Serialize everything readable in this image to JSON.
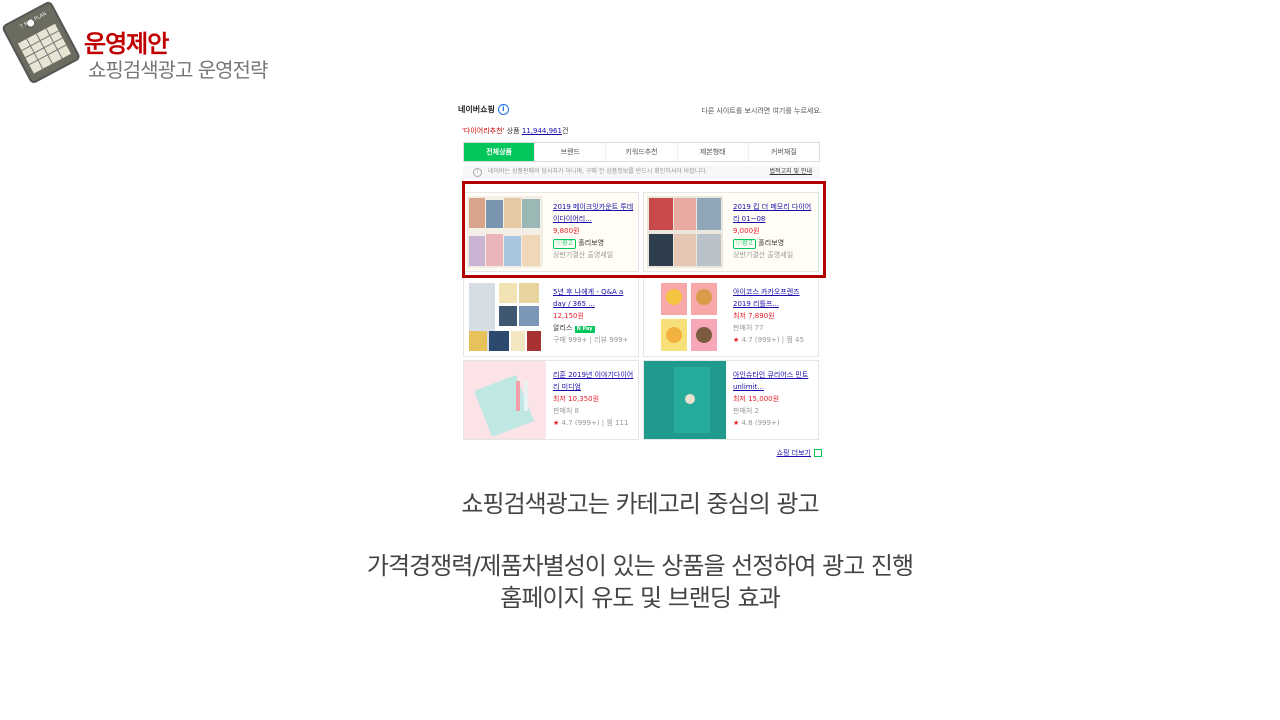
{
  "header": {
    "title": "운영제안",
    "subtitle": "쇼핑검색광고 운영전략",
    "tag_text": "T NAY PLAN"
  },
  "screenshot": {
    "brand": "네이버쇼핑",
    "other_site_note": "다른 사이트를 보시려면 여기를 누르세요.",
    "keyword": "'다이어리추천'",
    "count_label": "상품",
    "count_value": "11,944,961",
    "count_suffix": "건",
    "tabs": [
      "전체상품",
      "브랜드",
      "키워드추천",
      "제본형태",
      "커버재질"
    ],
    "notice": "네이버는 상품판매의 당사자가 아니며, 구매 전 상품정보를 반드시 확인하셔야 바랍니다.",
    "notice_link": "법적고지 및 안내",
    "products": [
      {
        "name": "2019 메이크잇카운트 투데이다이어리...",
        "price": "9,800원",
        "badge": "광고",
        "seller": "홀리보영",
        "extra": "상반기결산 출영세일",
        "is_ad": true
      },
      {
        "name": "2019 킵 더 메모리 다이어리 01~08",
        "price": "9,000원",
        "badge": "광고",
        "seller": "홀리보영",
        "extra": "상반기결산 출영세일",
        "is_ad": true
      },
      {
        "name": "5년 후 나에게 - Q&A a day / 365 ...",
        "price": "12,150원",
        "seller": "알리스",
        "npay": "N Pay",
        "extra": "구매 999+ | 리뷰 999+"
      },
      {
        "name": "아이코스 카카오프렌즈 2019 리틀프...",
        "price": "최저 7,890원",
        "seller": "판매처 77",
        "rating": "4.7 (999+) | 찜 45"
      },
      {
        "name": "리훈 2019년 이야기다이어리 미디엄",
        "price": "최저 10,350원",
        "seller": "판매처 8",
        "rating": "4.7 (999+) | 찜 111"
      },
      {
        "name": "아인슈타인 큐리어스 민트 unlimit...",
        "price": "최저 15,000원",
        "seller": "판매처 2",
        "rating": "4.8 (999+)"
      }
    ],
    "more_link": "쇼핑 더보기"
  },
  "captions": {
    "line1": "쇼핑검색광고는 카테고리 중심의 광고",
    "line2": "가격경쟁력/제품차별성이 있는 상품을 선정하여 광고 진행",
    "line3": "홈페이지 유도 및 브랜딩 효과"
  },
  "colors": {
    "accent": "#c00000",
    "naver_green": "#03c75a",
    "price_red": "#e5202e",
    "link_blue": "#1a0dab"
  }
}
